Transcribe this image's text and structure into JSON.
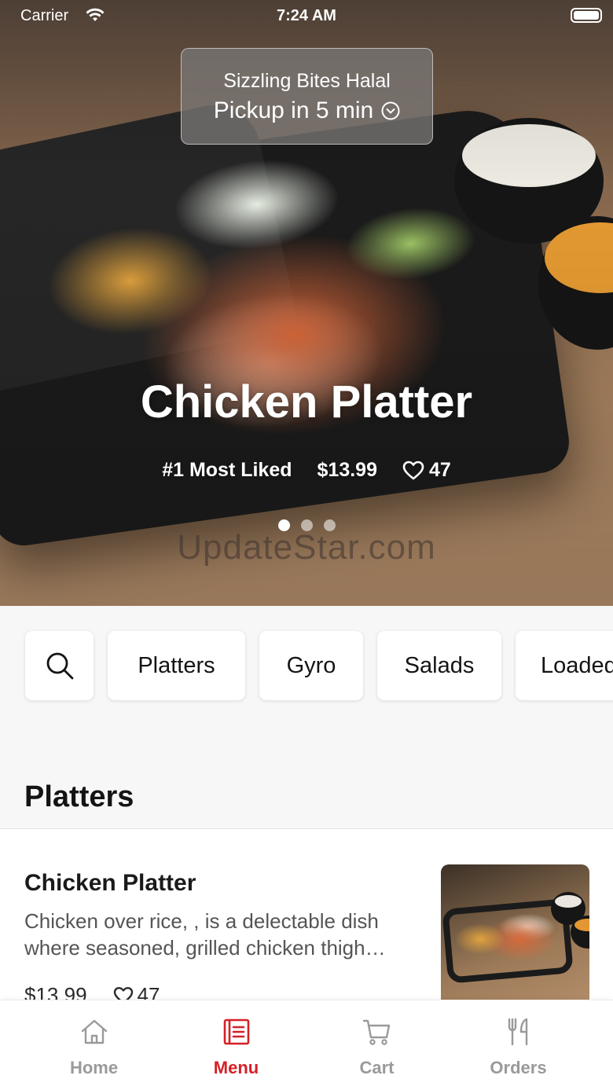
{
  "status_bar": {
    "carrier": "Carrier",
    "time": "7:24 AM"
  },
  "location": {
    "restaurant": "Sizzling Bites Halal",
    "pickup": "Pickup in 5 min"
  },
  "hero": {
    "title": "Chicken Platter",
    "badge": "#1 Most Liked",
    "price": "$13.99",
    "likes": "47",
    "carousel": {
      "page": 1,
      "pages": 3
    },
    "watermark": "UpdateStar.com"
  },
  "categories": [
    "Platters",
    "Gyro",
    "Salads",
    "Loaded"
  ],
  "section": {
    "title": "Platters"
  },
  "item": {
    "name": "Chicken Platter",
    "description": "Chicken over rice, , is a delectable dish where seasoned, grilled chicken thigh…",
    "price": "$13.99",
    "likes": "47"
  },
  "tabs": [
    {
      "label": "Home",
      "icon": "home-icon"
    },
    {
      "label": "Menu",
      "icon": "menu-list-icon"
    },
    {
      "label": "Cart",
      "icon": "cart-icon"
    },
    {
      "label": "Orders",
      "icon": "fork-knife-icon"
    }
  ],
  "colors": {
    "accent": "#d52027",
    "inactive": "#9a9a9a"
  }
}
